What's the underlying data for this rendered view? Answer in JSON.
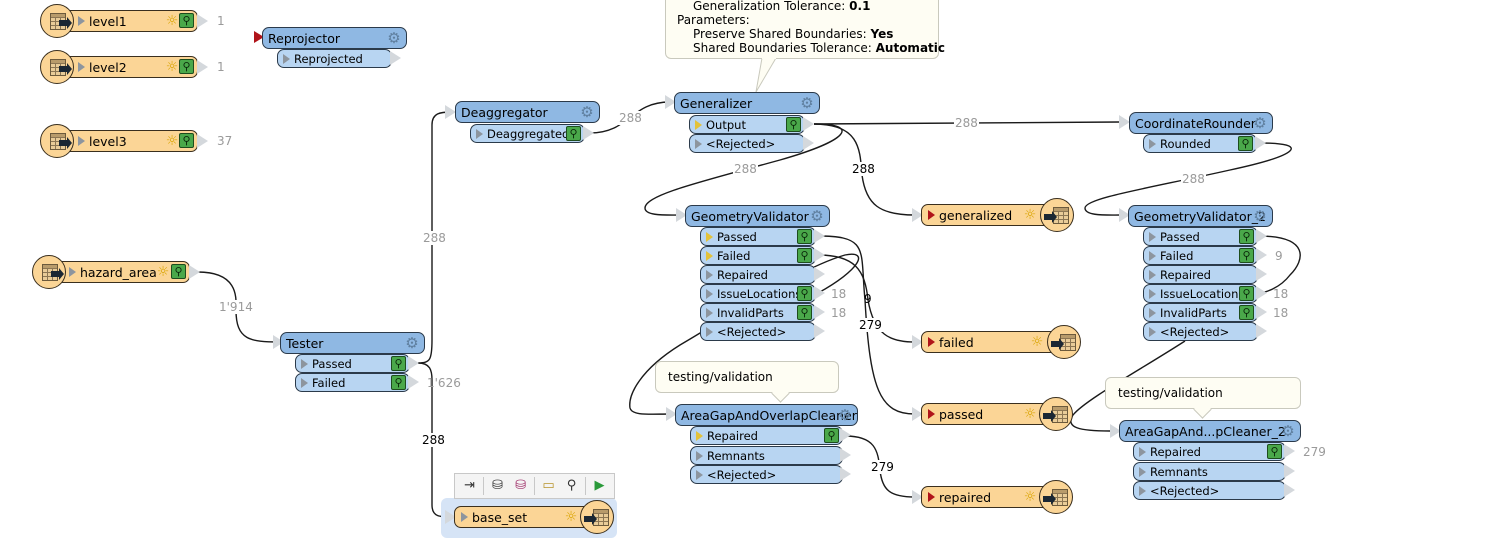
{
  "readers": {
    "level1": {
      "name": "level1",
      "count": "1"
    },
    "level2": {
      "name": "level2",
      "count": "1"
    },
    "level3": {
      "name": "level3",
      "count": "37"
    },
    "hazard_area": {
      "name": "hazard_area",
      "count": "1'914"
    }
  },
  "transformers": {
    "reprojector": {
      "name": "Reprojector",
      "ports": [
        "Reprojected"
      ]
    },
    "deaggregator": {
      "name": "Deaggregator",
      "ports": [
        "Deaggregated"
      ]
    },
    "generalizer": {
      "name": "Generalizer",
      "ports": [
        "Output",
        "<Rejected>"
      ]
    },
    "coordinate_rounder": {
      "name": "CoordinateRounder",
      "ports": [
        "Rounded"
      ]
    },
    "tester": {
      "name": "Tester",
      "ports": [
        "Passed",
        "Failed"
      ],
      "failed_count": "1'626"
    },
    "geometry_validator": {
      "name": "GeometryValidator",
      "ports": [
        "Passed",
        "Failed",
        "Repaired",
        "IssueLocations",
        "InvalidParts",
        "<Rejected>"
      ],
      "issue_count": "18",
      "invalid_count": "18"
    },
    "geometry_validator_2": {
      "name": "GeometryValidator_2",
      "ports": [
        "Passed",
        "Failed",
        "Repaired",
        "IssueLocations",
        "InvalidParts",
        "<Rejected>"
      ],
      "failed_count": "9",
      "issue_count": "18",
      "invalid_count": "18"
    },
    "area_cleaner": {
      "name": "AreaGapAndOverlapCleaner",
      "ports": [
        "Repaired",
        "Remnants",
        "<Rejected>"
      ]
    },
    "area_cleaner_2": {
      "name": "AreaGapAnd...pCleaner_2",
      "ports": [
        "Repaired",
        "Remnants",
        "<Rejected>"
      ],
      "repaired_count": "279"
    }
  },
  "writers": {
    "generalized": {
      "name": "generalized"
    },
    "failed": {
      "name": "failed"
    },
    "passed": {
      "name": "passed"
    },
    "repaired": {
      "name": "repaired"
    },
    "base_set": {
      "name": "base_set"
    }
  },
  "links": {
    "hazard_to_tester": "1'914",
    "tester_to_deagg": "288",
    "tester_to_base": "288",
    "deagg_to_gen": "288",
    "gen_to_rounder": "288",
    "gen_to_validator": "288",
    "gen_to_generalized": "288",
    "rounder_to_validator2": "288",
    "validator_failed": "9",
    "validator_passed": "279",
    "cleaner_repaired": "279"
  },
  "tooltip": {
    "line0_label": "Generalization Tolerance: ",
    "line0_value": "0.1",
    "heading": "Parameters:",
    "line1_label": "Preserve Shared Boundaries: ",
    "line1_value": "Yes",
    "line2_label": "Shared Boundaries Tolerance: ",
    "line2_value": "Automatic"
  },
  "annotations": {
    "cleaner": "testing/validation",
    "cleaner_2": "testing/validation"
  },
  "toolbar": {
    "items": [
      "add-reader-icon",
      "add-feature-type-icon",
      "feature-type-params-icon",
      "open-folder-icon",
      "inspect-icon",
      "run-to-this-icon"
    ]
  }
}
